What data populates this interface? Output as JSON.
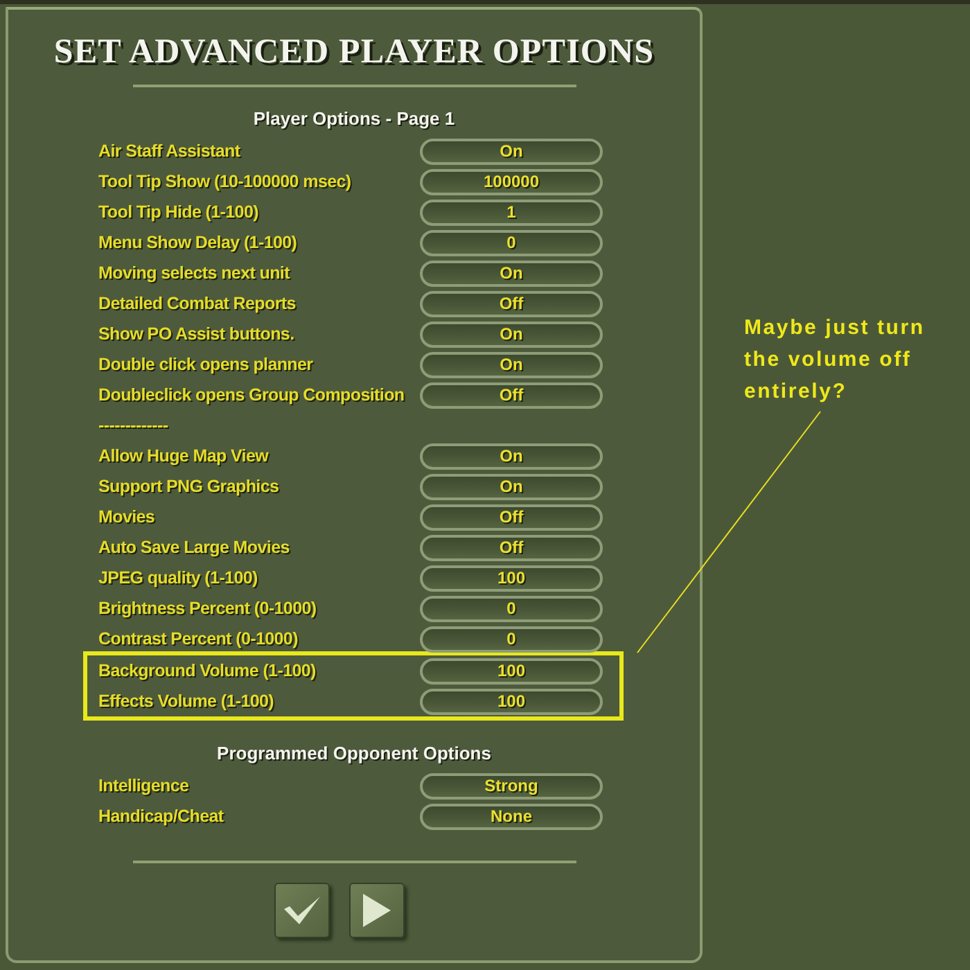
{
  "dialog": {
    "title": "SET ADVANCED PLAYER OPTIONS"
  },
  "sections": [
    {
      "heading": "Player Options - Page 1",
      "rows": [
        {
          "kind": "option",
          "label": "Air Staff Assistant",
          "value": "On",
          "highlighted": false
        },
        {
          "kind": "option",
          "label": "Tool Tip Show (10-100000 msec)",
          "value": "100000",
          "highlighted": false
        },
        {
          "kind": "option",
          "label": "Tool Tip Hide (1-100)",
          "value": "1",
          "highlighted": false
        },
        {
          "kind": "option",
          "label": "Menu Show Delay (1-100)",
          "value": "0",
          "highlighted": false
        },
        {
          "kind": "option",
          "label": "Moving selects next unit",
          "value": "On",
          "highlighted": false
        },
        {
          "kind": "option",
          "label": "Detailed Combat Reports",
          "value": "Off",
          "highlighted": false
        },
        {
          "kind": "option",
          "label": "Show PO Assist buttons.",
          "value": "On",
          "highlighted": false
        },
        {
          "kind": "option",
          "label": "Double click opens planner",
          "value": "On",
          "highlighted": false
        },
        {
          "kind": "option",
          "label": "Doubleclick opens Group Composition",
          "value": "Off",
          "highlighted": false
        },
        {
          "kind": "separator",
          "label": "-------------",
          "highlighted": false
        },
        {
          "kind": "option",
          "label": "Allow Huge Map View",
          "value": "On",
          "highlighted": false
        },
        {
          "kind": "option",
          "label": "Support PNG Graphics",
          "value": "On",
          "highlighted": false
        },
        {
          "kind": "option",
          "label": "Movies",
          "value": "Off",
          "highlighted": false
        },
        {
          "kind": "option",
          "label": "Auto Save Large Movies",
          "value": "Off",
          "highlighted": false
        },
        {
          "kind": "option",
          "label": "JPEG quality (1-100)",
          "value": "100",
          "highlighted": false
        },
        {
          "kind": "option",
          "label": "Brightness Percent (0-1000)",
          "value": "0",
          "highlighted": false
        },
        {
          "kind": "option",
          "label": "Contrast Percent (0-1000)",
          "value": "0",
          "highlighted": false
        },
        {
          "kind": "option",
          "label": "Background Volume (1-100)",
          "value": "100",
          "highlighted": true
        },
        {
          "kind": "option",
          "label": "Effects Volume (1-100)",
          "value": "100",
          "highlighted": true
        }
      ]
    },
    {
      "heading": "Programmed Opponent Options",
      "rows": [
        {
          "kind": "option",
          "label": "Intelligence",
          "value": "Strong",
          "highlighted": false
        },
        {
          "kind": "option",
          "label": "Handicap/Cheat",
          "value": "None",
          "highlighted": false
        }
      ]
    }
  ],
  "footer_buttons": [
    {
      "kind": "confirm"
    },
    {
      "kind": "next"
    }
  ],
  "callout": {
    "text": "Maybe just turn the volume off entirely?"
  }
}
